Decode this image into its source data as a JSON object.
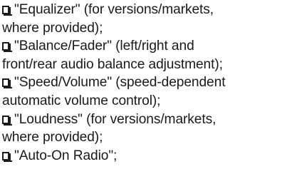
{
  "items": [
    {
      "lines": [
        "\"Equalizer\" (for versions/markets,",
        "where provided);"
      ]
    },
    {
      "lines": [
        "\"Balance/Fader\" (left/right and",
        "front/rear audio balance adjustment);"
      ]
    },
    {
      "lines": [
        "\"Speed/Volume\" (speed-dependent",
        "automatic volume control);"
      ]
    },
    {
      "lines": [
        "\"Loudness\" (for versions/markets,",
        "where provided);"
      ]
    },
    {
      "lines": [
        "\"Auto-On Radio\";"
      ]
    }
  ],
  "icon": "checkbox-icon"
}
